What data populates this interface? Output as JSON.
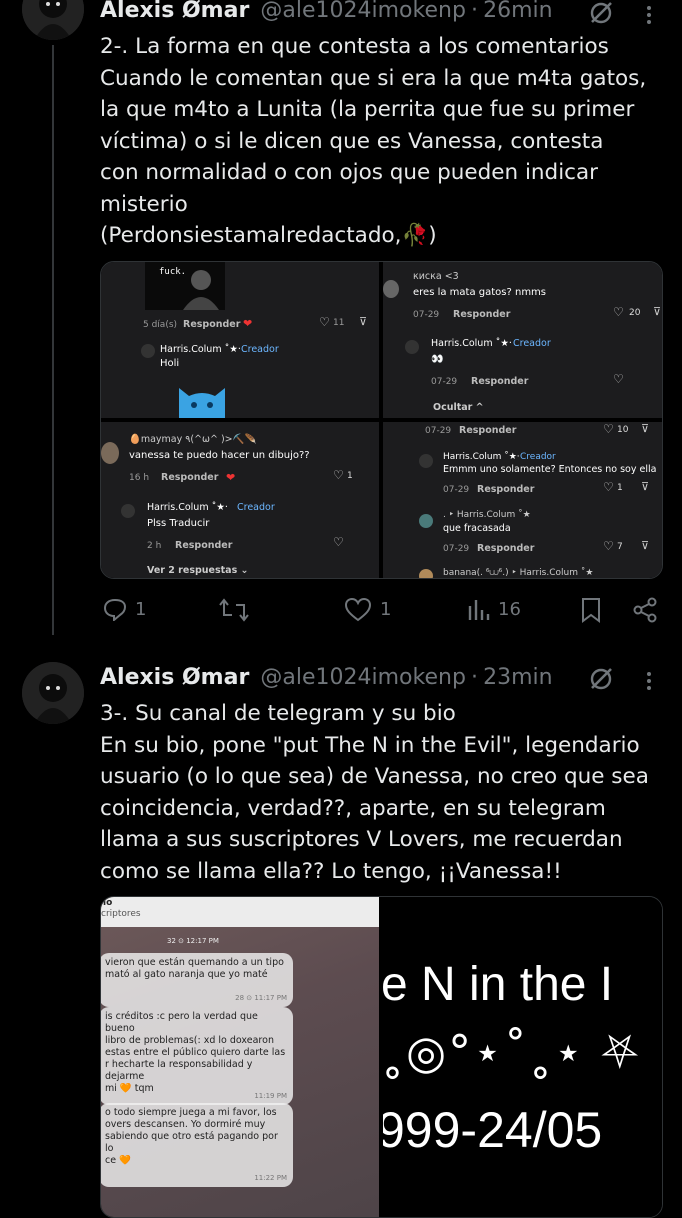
{
  "tweets": [
    {
      "author": "Alexis Ømar",
      "handle": "@ale1024imokenp",
      "dot": "·",
      "time": "26min",
      "body": "2-. La forma en que contesta a los comentarios\nCuando le comentan que si era la que m4ta gatos,\nla que m4to a Lunita (la perrita que fue su primer\nvíctima) o si le dicen que es Vanessa, contesta\ncon normalidad o con ojos que pueden indicar\nmisterio\n(Perdonsiestamalredactado,🥀)",
      "actions": {
        "replies": "1",
        "retweets": "",
        "likes": "1",
        "views": "16"
      }
    },
    {
      "author": "Alexis Ømar",
      "handle": "@ale1024imokenp",
      "dot": "·",
      "time": "23min",
      "body": "3-. Su canal de telegram y su bio\nEn su bio, pone \"put The N in the Evil\", legendario\nusuario (o lo que sea) de Vanessa, no creo que sea\ncoincidencia, verdad??, aparte, en su telegram\nllama a sus suscriptores V Lovers, me recuerdan\ncomo se llama ella?? Lo tengo, ¡¡Vanessa!!"
    }
  ],
  "media1": {
    "q1": {
      "img_text": "fuck.",
      "time": "5 día(s)",
      "reply": "Responder",
      "likes": "11",
      "creator": "Harris.Colum ˚★·",
      "creator_tag": "Creador",
      "creator_text": "Holi"
    },
    "q2": {
      "user": "киска <3",
      "text": "eres la mata gatos? nmms",
      "time": "07-29",
      "reply": "Responder",
      "likes": "20",
      "creator": "Harris.Colum ˚★·",
      "creator_tag": "Creador",
      "creator_text": "👀",
      "time2": "07-29",
      "reply2": "Responder",
      "hide": "Ocultar ^"
    },
    "q3": {
      "user": "🥚maymay ٩(^ω^ )>⛏️🪶",
      "text": "vanessa te puedo hacer un dibujo??",
      "time": "16 h",
      "reply": "Responder",
      "likes": "1",
      "creator": "Harris.Colum ˚★·",
      "creator_tag": "Creador",
      "creator_text": "Plss Traducir",
      "time2": "2 h",
      "reply2": "Responder",
      "more": "Ver 2 respuestas ⌄"
    },
    "q4": {
      "time": "07-29",
      "reply": "Responder",
      "likes": "10",
      "creator": "Harris.Colum ˚★·",
      "creator_tag": "Creador",
      "creator_text": "Emmm uno solamente? Entonces no soy ella",
      "time2": "07-29",
      "reply2": "Responder",
      "likes2": "1",
      "user3": ". ‣ Harris.Colum ˚★",
      "text3": "que fracasada",
      "time3": "07-29",
      "reply3": "Responder",
      "likes3": "7",
      "user4": "banana(. ⁶⩊⁶.) ‣ Harris.Colum ˚★"
    }
  },
  "media2": {
    "header_a": "lo",
    "header_b": "criptores",
    "msgs": [
      {
        "text": "vieron que están quemando a un tipo\nmató al gato naranja que yo maté",
        "meta": "28 ⊙ 11:17 PM"
      },
      {
        "text": "is créditos :c pero la verdad que bueno\nlibro de problemas(: xd lo doxearon\nestas entre el público quiero darte las\nr hecharte la responsabilidad y dejarme\nmi 🧡 tqm",
        "meta": "11:19 PM"
      },
      {
        "text": "o todo siempre juega a mi favor, los\novers descansen. Yo dormiré muy\nsabiendo que otro está pagando por lo\nce 🧡",
        "meta": "11:22 PM"
      }
    ],
    "top_meta": "32 ⊙ 12:17 PM",
    "bio_line1": "e N in the I",
    "bio_line2": "˳◎°⋆˚˳⋆ ⛧",
    "bio_line3": "999-24/05"
  },
  "colors": {
    "accent": "#1d9bf0",
    "muted": "#71767b",
    "bg": "#000000",
    "text": "#e7e9ea"
  },
  "icons": [
    "reply-icon",
    "retweet-icon",
    "like-icon",
    "views-icon",
    "bookmark-icon",
    "share-icon",
    "grok-icon",
    "more-icon"
  ]
}
